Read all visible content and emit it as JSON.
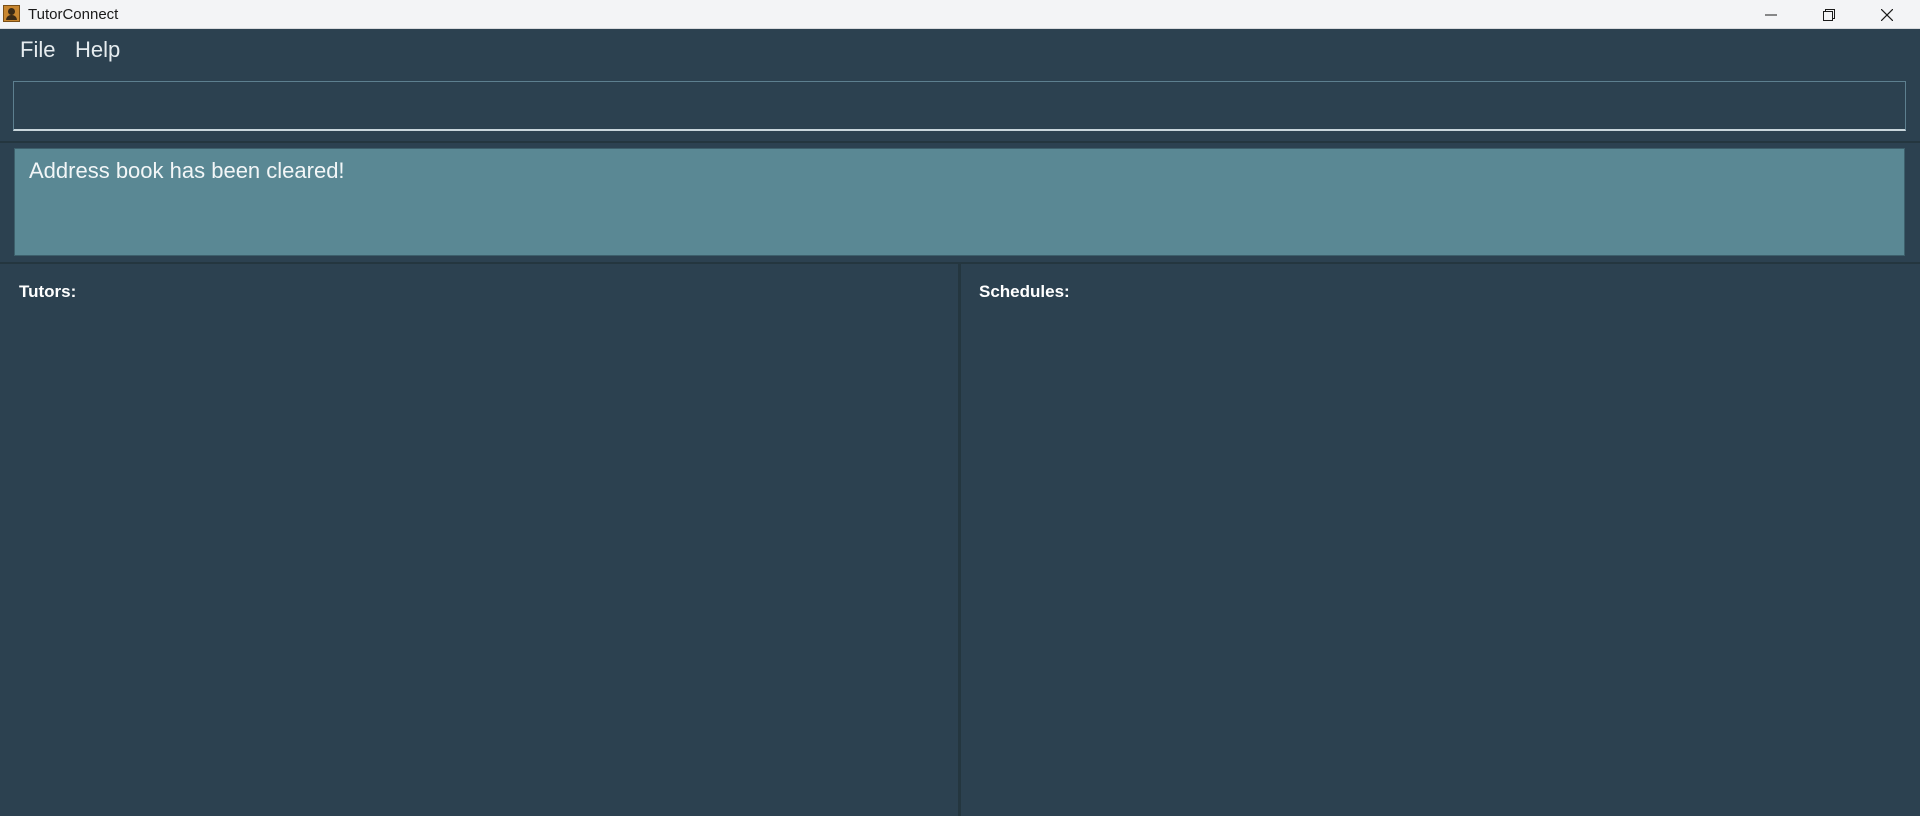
{
  "window": {
    "title": "TutorConnect",
    "controls": {
      "minimize": "minimize-icon",
      "maximize": "restore-icon",
      "close": "close-icon"
    }
  },
  "menu": {
    "items": [
      {
        "label": "File"
      },
      {
        "label": "Help"
      }
    ]
  },
  "command": {
    "value": "",
    "placeholder": ""
  },
  "result": {
    "message": "Address book has been cleared!"
  },
  "panels": {
    "tutors": {
      "title": "Tutors:",
      "items": []
    },
    "schedules": {
      "title": "Schedules:",
      "items": []
    }
  },
  "colors": {
    "background": "#2c4150",
    "result_box": "#5a8894",
    "titlebar": "#f3f4f6"
  }
}
